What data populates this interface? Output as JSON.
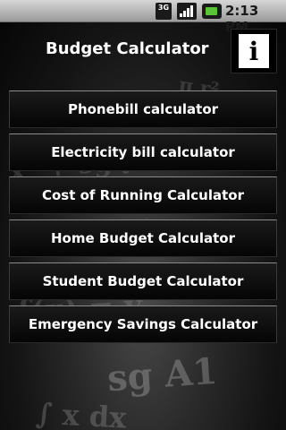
{
  "status_bar": {
    "network_label": "3G",
    "time": "2:13 PM",
    "icons": [
      "network-3g-icon",
      "signal-icon",
      "battery-icon"
    ]
  },
  "header": {
    "title": "Budget Calculator",
    "info_glyph": "i"
  },
  "menu": {
    "items": [
      {
        "label": "Phonebill calculator"
      },
      {
        "label": "Electricity bill calculator"
      },
      {
        "label": "Cost of Running Calculator"
      },
      {
        "label": "Home Budget Calculator"
      },
      {
        "label": "Student Budget Calculator"
      },
      {
        "label": "Emergency Savings Calculator"
      }
    ]
  },
  "colors": {
    "button_text": "#ffffff",
    "battery": "#59c33a",
    "status_bar": "#bdbdbd"
  }
}
